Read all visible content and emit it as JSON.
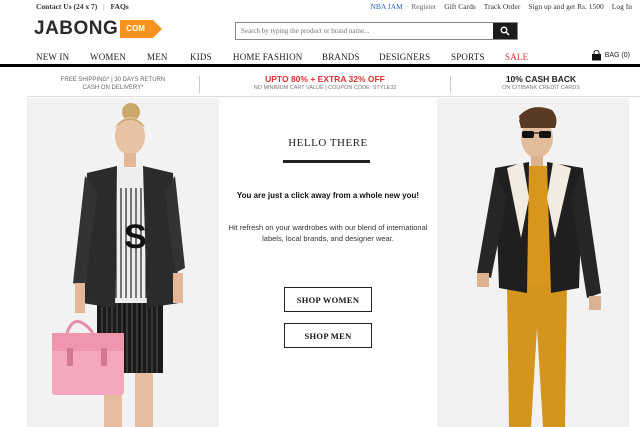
{
  "topbar": {
    "contact": "Contact Us (24 x 7)",
    "faqs": "FAQs",
    "nba": "NBA JAM",
    "register": "Register",
    "gift_cards": "Gift Cards",
    "track_order": "Track Order",
    "signup": "Sign up and get Rs. 1500",
    "login": "Log In"
  },
  "logo": {
    "word": "JABONG",
    "badge": "COM"
  },
  "search": {
    "placeholder": "Search by typing the product or brand name..."
  },
  "nav": {
    "items": [
      "NEW IN",
      "WOMEN",
      "MEN",
      "KIDS",
      "HOME FASHION",
      "BRANDS",
      "DESIGNERS",
      "SPORTS",
      "SALE"
    ],
    "bag_label": "BAG (0)"
  },
  "promo": {
    "p1_line1": "FREE SHIPPING* | 30 DAYS RETURN",
    "p1_line2": "CASH ON DELIVERY*",
    "p2_big": "UPTO 80% + EXTRA 32% OFF",
    "p2_small": "NO MINIMUM CART VALUE | COUPON CODE: STYLE32",
    "p3_big": "10% CASH BACK",
    "p3_small": "ON CITIBANK CREDIT CARDS"
  },
  "hero": {
    "title": "HELLO THERE",
    "tagline": "You are just a click away from a whole new you!",
    "description": "Hit refresh on your wardrobes with our blend of international labels, local brands, and designer wear.",
    "shop_women": "SHOP WOMEN",
    "shop_men": "SHOP MEN"
  },
  "colors": {
    "accent": "#f7931e",
    "sale": "#e03030",
    "link": "#2a5fb8"
  }
}
